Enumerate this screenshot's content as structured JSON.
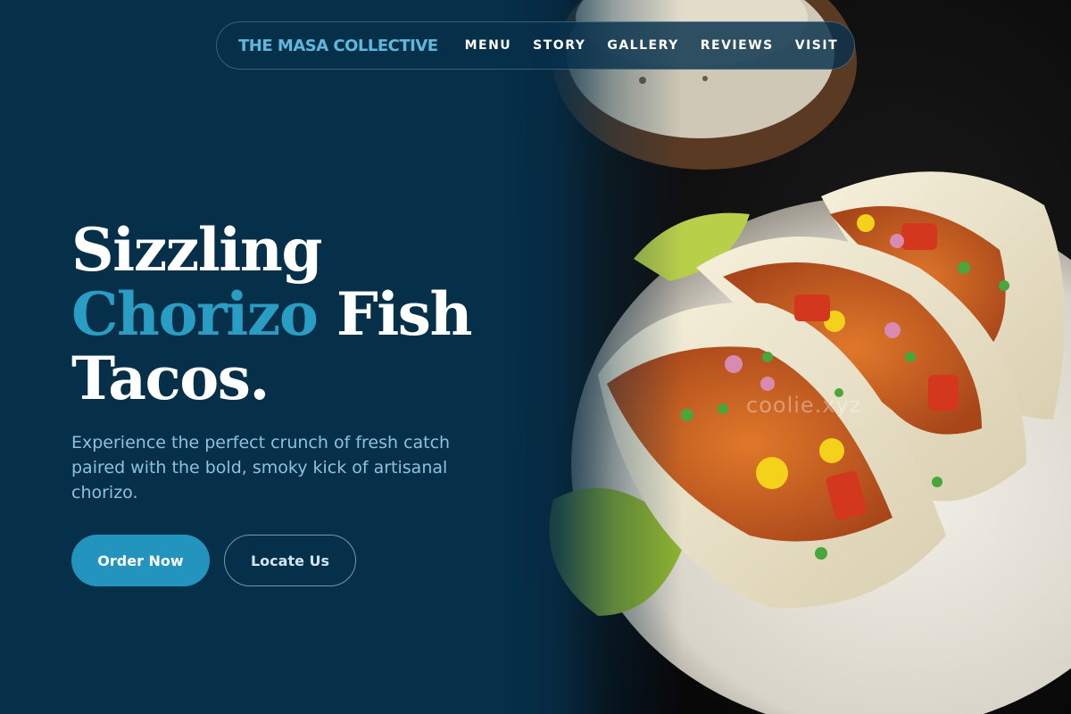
{
  "nav": {
    "brand": "THE MASA COLLECTIVE",
    "links": [
      "MENU",
      "STORY",
      "GALLERY",
      "REVIEWS",
      "VISIT"
    ]
  },
  "hero": {
    "line1": "Sizzling",
    "accent_word": "Chorizo",
    "line2_rest": " Fish",
    "line3": "Tacos.",
    "subtitle": "Experience the perfect crunch of fresh catch paired with the bold, smoky kick of artisanal chorizo.",
    "primary_cta": "Order Now",
    "secondary_cta": "Locate Us"
  },
  "image": {
    "watermark": "coolie.xyz"
  },
  "colors": {
    "background": "#062f4a",
    "accent": "#2a9dc4",
    "brand": "#5fb7dc",
    "button_primary": "#2394bd"
  }
}
